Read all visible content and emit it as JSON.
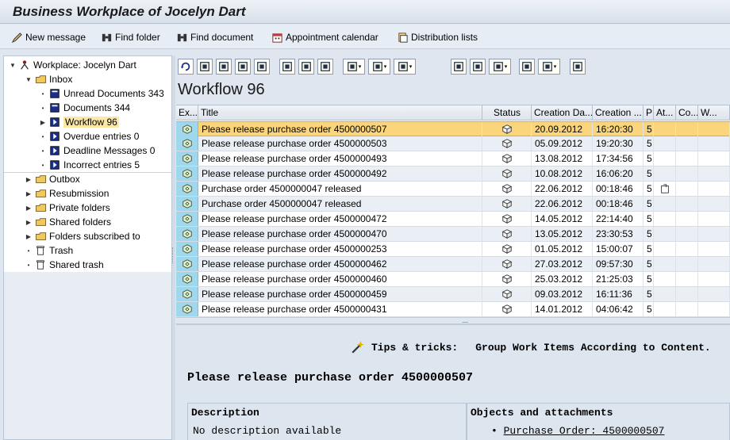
{
  "window": {
    "title": "Business Workplace of Jocelyn Dart"
  },
  "toolbar": {
    "new_message": "New message",
    "find_folder": "Find folder",
    "find_document": "Find document",
    "appointment_calendar": "Appointment calendar",
    "distribution_lists": "Distribution lists"
  },
  "tree": {
    "root": "Workplace: Jocelyn Dart",
    "inbox": "Inbox",
    "unread": "Unread Documents 343",
    "documents": "Documents 344",
    "workflow": "Workflow 96",
    "overdue": "Overdue entries 0",
    "deadline": "Deadline Messages 0",
    "incorrect": "Incorrect entries 5",
    "outbox": "Outbox",
    "resubmission": "Resubmission",
    "private": "Private folders",
    "shared": "Shared folders",
    "subscribed": "Folders subscribed to",
    "trash": "Trash",
    "shared_trash": "Shared trash"
  },
  "list": {
    "title": "Workflow 96",
    "columns": {
      "exc": "Ex...",
      "title": "Title",
      "status": "Status",
      "creation_date": "Creation Da...",
      "creation_time": "Creation ...",
      "priority": "P",
      "attachments": "At...",
      "col_co": "Co...",
      "col_w": "W..."
    },
    "rows": [
      {
        "title": "Please release purchase order 4500000507",
        "date": "20.09.2012",
        "time": "16:20:30",
        "prio": "5",
        "attach": false
      },
      {
        "title": "Please release purchase order 4500000503",
        "date": "05.09.2012",
        "time": "19:20:30",
        "prio": "5",
        "attach": false
      },
      {
        "title": "Please release purchase order 4500000493",
        "date": "13.08.2012",
        "time": "17:34:56",
        "prio": "5",
        "attach": false
      },
      {
        "title": "Please release purchase order 4500000492",
        "date": "10.08.2012",
        "time": "16:06:20",
        "prio": "5",
        "attach": false
      },
      {
        "title": "Purchase order 4500000047 released",
        "date": "22.06.2012",
        "time": "00:18:46",
        "prio": "5",
        "attach": true
      },
      {
        "title": "Purchase order 4500000047 released",
        "date": "22.06.2012",
        "time": "00:18:46",
        "prio": "5",
        "attach": false
      },
      {
        "title": "Please release purchase order 4500000472",
        "date": "14.05.2012",
        "time": "22:14:40",
        "prio": "5",
        "attach": false
      },
      {
        "title": "Please release purchase order 4500000470",
        "date": "13.05.2012",
        "time": "23:30:53",
        "prio": "5",
        "attach": false
      },
      {
        "title": "Please release purchase order 4500000253",
        "date": "01.05.2012",
        "time": "15:00:07",
        "prio": "5",
        "attach": false
      },
      {
        "title": "Please release purchase order 4500000462",
        "date": "27.03.2012",
        "time": "09:57:30",
        "prio": "5",
        "attach": false
      },
      {
        "title": "Please release purchase order 4500000460",
        "date": "25.03.2012",
        "time": "21:25:03",
        "prio": "5",
        "attach": false
      },
      {
        "title": "Please release purchase order 4500000459",
        "date": "09.03.2012",
        "time": "16:11:36",
        "prio": "5",
        "attach": false
      },
      {
        "title": "Please release purchase order 4500000431",
        "date": "14.01.2012",
        "time": "04:06:42",
        "prio": "5",
        "attach": false
      }
    ],
    "selected_index": 0
  },
  "preview": {
    "tips_label": "Tips & tricks:",
    "tips_text": "Group Work Items According to Content.",
    "subject": "Please release purchase order 4500000507",
    "description_header": "Description",
    "description_text": "No description available",
    "objects_header": "Objects and attachments",
    "object_link": "Purchase Order: 4500000507"
  },
  "colors": {
    "selection": "#fbd57c",
    "exception_column": "#9fd7ec",
    "background": "#dfe6ef"
  }
}
